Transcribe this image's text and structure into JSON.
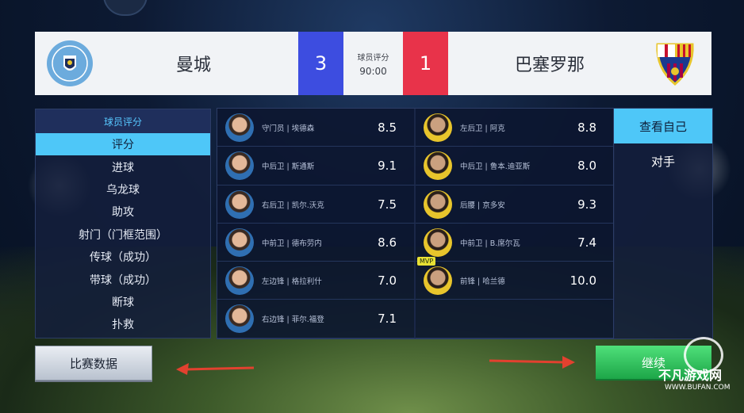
{
  "scoreboard": {
    "home_team": "曼城",
    "away_team": "巴塞罗那",
    "home_score": "3",
    "away_score": "1",
    "center_label": "球员评分",
    "match_time": "90:00"
  },
  "categories": {
    "header": "球员评分",
    "items": [
      "评分",
      "进球",
      "乌龙球",
      "助攻",
      "射门（门框范围）",
      "传球（成功）",
      "带球（成功）",
      "断球",
      "扑救"
    ],
    "active_index": 0
  },
  "players": {
    "home": [
      {
        "label": "守门员 | 埃德森",
        "rating": "8.5"
      },
      {
        "label": "中后卫 | 斯通斯",
        "rating": "9.1"
      },
      {
        "label": "右后卫 | 凯尔.沃克",
        "rating": "7.5"
      },
      {
        "label": "中前卫 | 德布劳内",
        "rating": "8.6"
      },
      {
        "label": "左边锋 | 格拉利什",
        "rating": "7.0"
      },
      {
        "label": "右边锋 | 菲尔.福登",
        "rating": "7.1"
      }
    ],
    "away": [
      {
        "label": "左后卫 | 阿克",
        "rating": "8.8"
      },
      {
        "label": "中后卫 | 鲁本.迪亚斯",
        "rating": "8.0"
      },
      {
        "label": "后腰 | 京多安",
        "rating": "9.3"
      },
      {
        "label": "中前卫 | B.席尔瓦",
        "rating": "7.4"
      },
      {
        "label": "前锋 | 哈兰德",
        "rating": "10.0",
        "badge": "MVP"
      }
    ]
  },
  "side_tabs": [
    "查看自己",
    "对手"
  ],
  "buttons": {
    "stats": "比赛数据",
    "continue": "继续"
  },
  "watermark": {
    "text": "不凡游戏网",
    "url": "WWW.BUFAN.COM"
  },
  "colors": {
    "home": "#3d4de0",
    "away": "#e8334a",
    "accent": "#4ec7f8",
    "continue": "#1da648",
    "arrow": "#e2412f"
  }
}
